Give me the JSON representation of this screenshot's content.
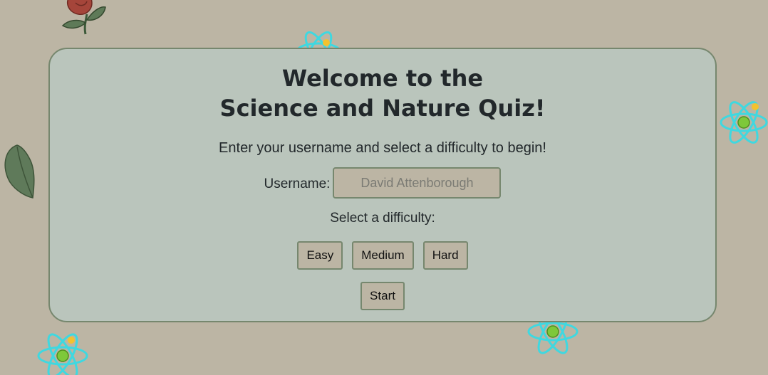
{
  "colors": {
    "page_background": "#bcb5a4",
    "panel_background": "#bac5bc",
    "panel_border": "#76876e",
    "text": "#22282b",
    "atom_accent": "#3fd8e0"
  },
  "decorations": [
    "rose-icon",
    "leaf-icon",
    "atom-icon"
  ],
  "quiz": {
    "title_line1": "Welcome to the",
    "title_line2": "Science and Nature Quiz!",
    "intro": "Enter your username and select a difficulty to begin!",
    "username_label": "Username:",
    "username_placeholder": "David Attenborough",
    "difficulty_label": "Select a difficulty:",
    "difficulties": [
      "Easy",
      "Medium",
      "Hard"
    ],
    "start_label": "Start"
  }
}
